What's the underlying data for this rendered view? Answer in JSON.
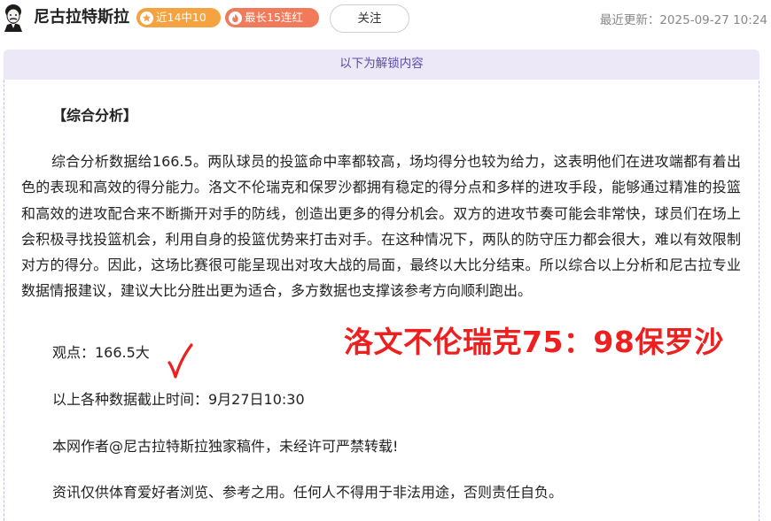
{
  "header": {
    "author_name": "尼古拉特斯拉",
    "badge_recent": "近14中10",
    "badge_streak": "最长15连红",
    "follow_label": "关注",
    "update_time": "最近更新：2025-09-27 10:24"
  },
  "unlock": {
    "banner": "以下为解锁内容"
  },
  "article": {
    "section_title": "【综合分析】",
    "paragraph": "综合分析数据给166.5。两队球员的投篮命中率都较高，场均得分也较为给力，这表明他们在进攻端都有着出色的表现和高效的得分能力。洛文不伦瑞克和保罗沙都拥有稳定的得分点和多样的进攻手段，能够通过精准的投篮和高效的进攻配合来不断撕开对手的防线，创造出更多的得分机会。双方的进攻节奏可能会非常快，球员们在场上会积极寻找投篮机会，利用自身的投篮优势来打击对手。在这种情况下，两队的防守压力都会很大，难以有效限制对方的得分。因此，这场比赛很可能呈现出对攻大战的局面，最终以大比分结束。所以综合以上分析和尼古拉专业数据情报建议，建议大比分胜出更为适合，多方数据也支撑该参考方向顺利跑出。",
    "viewpoint": "观点：166.5大",
    "cutoff": "以上各种数据截止时间：9月27日10:30",
    "copyright": "本网作者@尼古拉特斯拉独家稿件，未经许可严禁转载!",
    "disclaimer": "资讯仅供体育爱好者浏览、参考之用。任何人不得用于非法用途，否则责任自负。"
  },
  "overlay": {
    "score_text": "洛文不伦瑞克75：98保罗沙",
    "color": "#ee1f1f"
  },
  "icons": {
    "avatar": "portrait-avatar",
    "badge_recent": "star-icon",
    "badge_streak": "flame-icon",
    "check": "check-mark-icon"
  }
}
